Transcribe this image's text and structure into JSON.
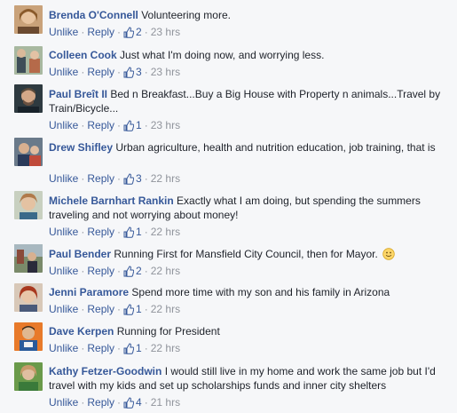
{
  "comments": [
    {
      "author": "Brenda O'Connell",
      "text": "Volunteering more.",
      "unlike": "Unlike",
      "reply": "Reply",
      "likes": "2",
      "time": "23 hrs"
    },
    {
      "author": "Colleen Cook",
      "text": "Just what I'm doing now, and worrying less.",
      "unlike": "Unlike",
      "reply": "Reply",
      "likes": "3",
      "time": "23 hrs"
    },
    {
      "author": "Paul Breît II",
      "text": "Bed n Breakfast...Buy a Big House with Property n animals...Travel by Train/Bicycle...",
      "unlike": "Unlike",
      "reply": "Reply",
      "likes": "1",
      "time": "23 hrs"
    },
    {
      "author": "Drew Shifley",
      "text": "Urban agriculture, health and nutrition education, job training, that is",
      "unlike": "Unlike",
      "reply": "Reply",
      "likes": "3",
      "time": "22 hrs"
    },
    {
      "author": "Michele Barnhart Rankin",
      "text": "Exactly what I am doing, but spending the summers traveling and not worrying about money!",
      "unlike": "Unlike",
      "reply": "Reply",
      "likes": "1",
      "time": "22 hrs"
    },
    {
      "author": "Paul Bender",
      "text": "Running First for Mansfield City Council, then for Mayor.",
      "unlike": "Unlike",
      "reply": "Reply",
      "likes": "2",
      "time": "22 hrs"
    },
    {
      "author": "Jenni Paramore",
      "text": "Spend more time with my son and his family in Arizona",
      "unlike": "Unlike",
      "reply": "Reply",
      "likes": "1",
      "time": "22 hrs"
    },
    {
      "author": "Dave Kerpen",
      "text": "Running for President",
      "unlike": "Unlike",
      "reply": "Reply",
      "likes": "1",
      "time": "22 hrs"
    },
    {
      "author": "Kathy Fetzer-Goodwin",
      "text": "I would still live in my home and work the same job but I'd travel with my kids and set up scholarships funds and inner city shelters",
      "unlike": "Unlike",
      "reply": "Reply",
      "likes": "4",
      "time": "21 hrs"
    }
  ],
  "icons": {
    "like": "thumbs-up-icon",
    "emoji": "smile-emoji-icon"
  },
  "colors": {
    "link": "#365899",
    "meta": "#90949c",
    "background": "#f6f7f9"
  }
}
